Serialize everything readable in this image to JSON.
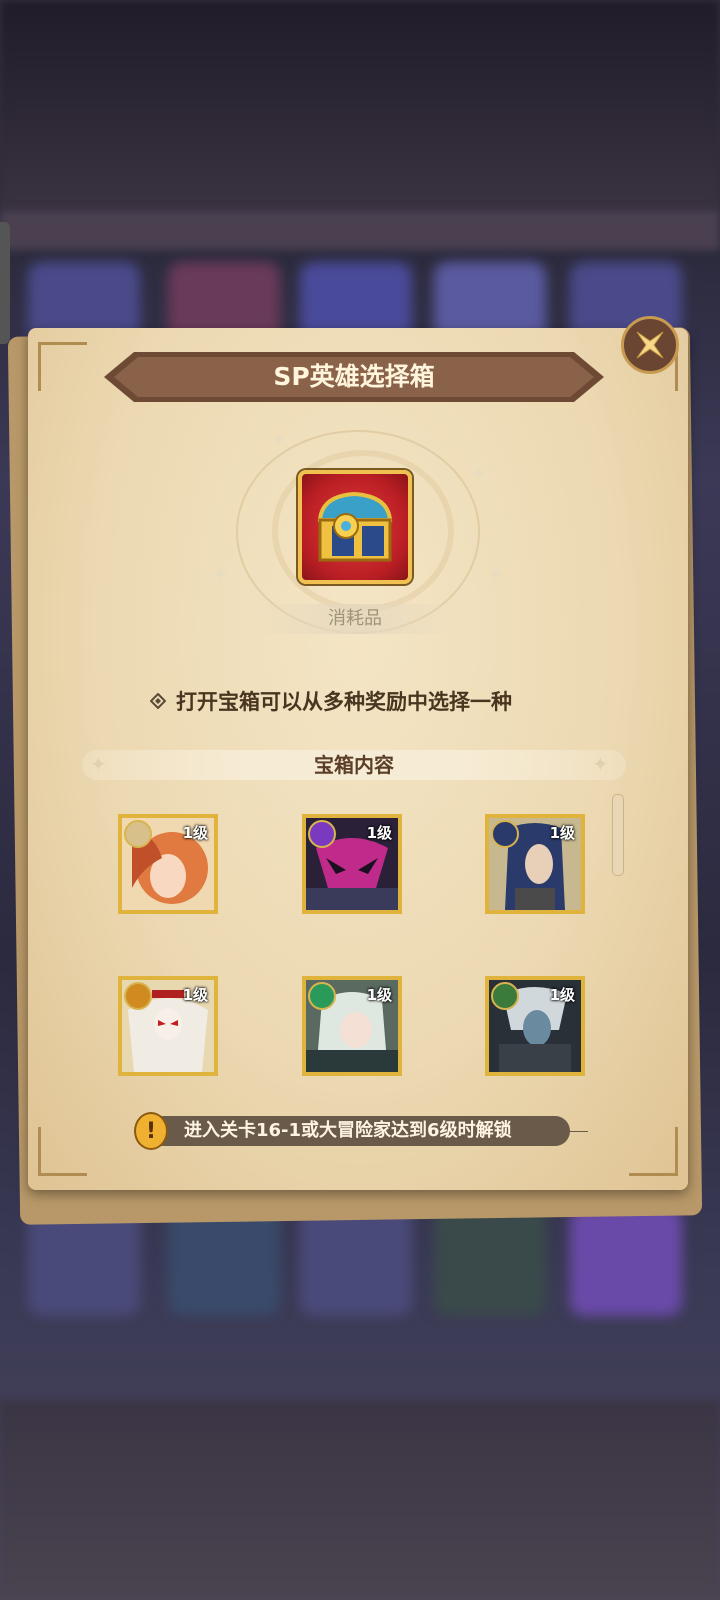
{
  "dialog": {
    "title": "SP英雄选择箱",
    "item_icon": "treasure-chest-icon",
    "item_type": "消耗品",
    "description": "打开宝箱可以从多种奖励中选择一种",
    "contents_header": "宝箱内容",
    "close_icon": "close-x-icon"
  },
  "heroes": [
    {
      "level": "1级",
      "faction": "celestial",
      "faction_color": "#d8c08a",
      "portrait_color": "#e07a40"
    },
    {
      "level": "1级",
      "faction": "hypogean",
      "faction_color": "#7a3ac0",
      "portrait_color": "#c02a8a"
    },
    {
      "level": "1级",
      "faction": "celestial",
      "faction_color": "#2a3a6a",
      "portrait_color": "#3a4a7a"
    },
    {
      "level": "1级",
      "faction": "graveborn",
      "faction_color": "#d08a20",
      "portrait_color": "#e8e0d0"
    },
    {
      "level": "1级",
      "faction": "wilder",
      "faction_color": "#2a9a5a",
      "portrait_color": "#dfe8e0"
    },
    {
      "level": "1级",
      "faction": "wilder",
      "faction_color": "#3a7a3a",
      "portrait_color": "#6a8aa0"
    }
  ],
  "unlock": {
    "text": "进入关卡16-1或大冒险家达到6级时解锁",
    "icon": "exclamation-icon"
  },
  "colors": {
    "accent_gold": "#e0b43c",
    "banner_brown": "#6e4a35",
    "parchment": "#ecd9b2"
  }
}
